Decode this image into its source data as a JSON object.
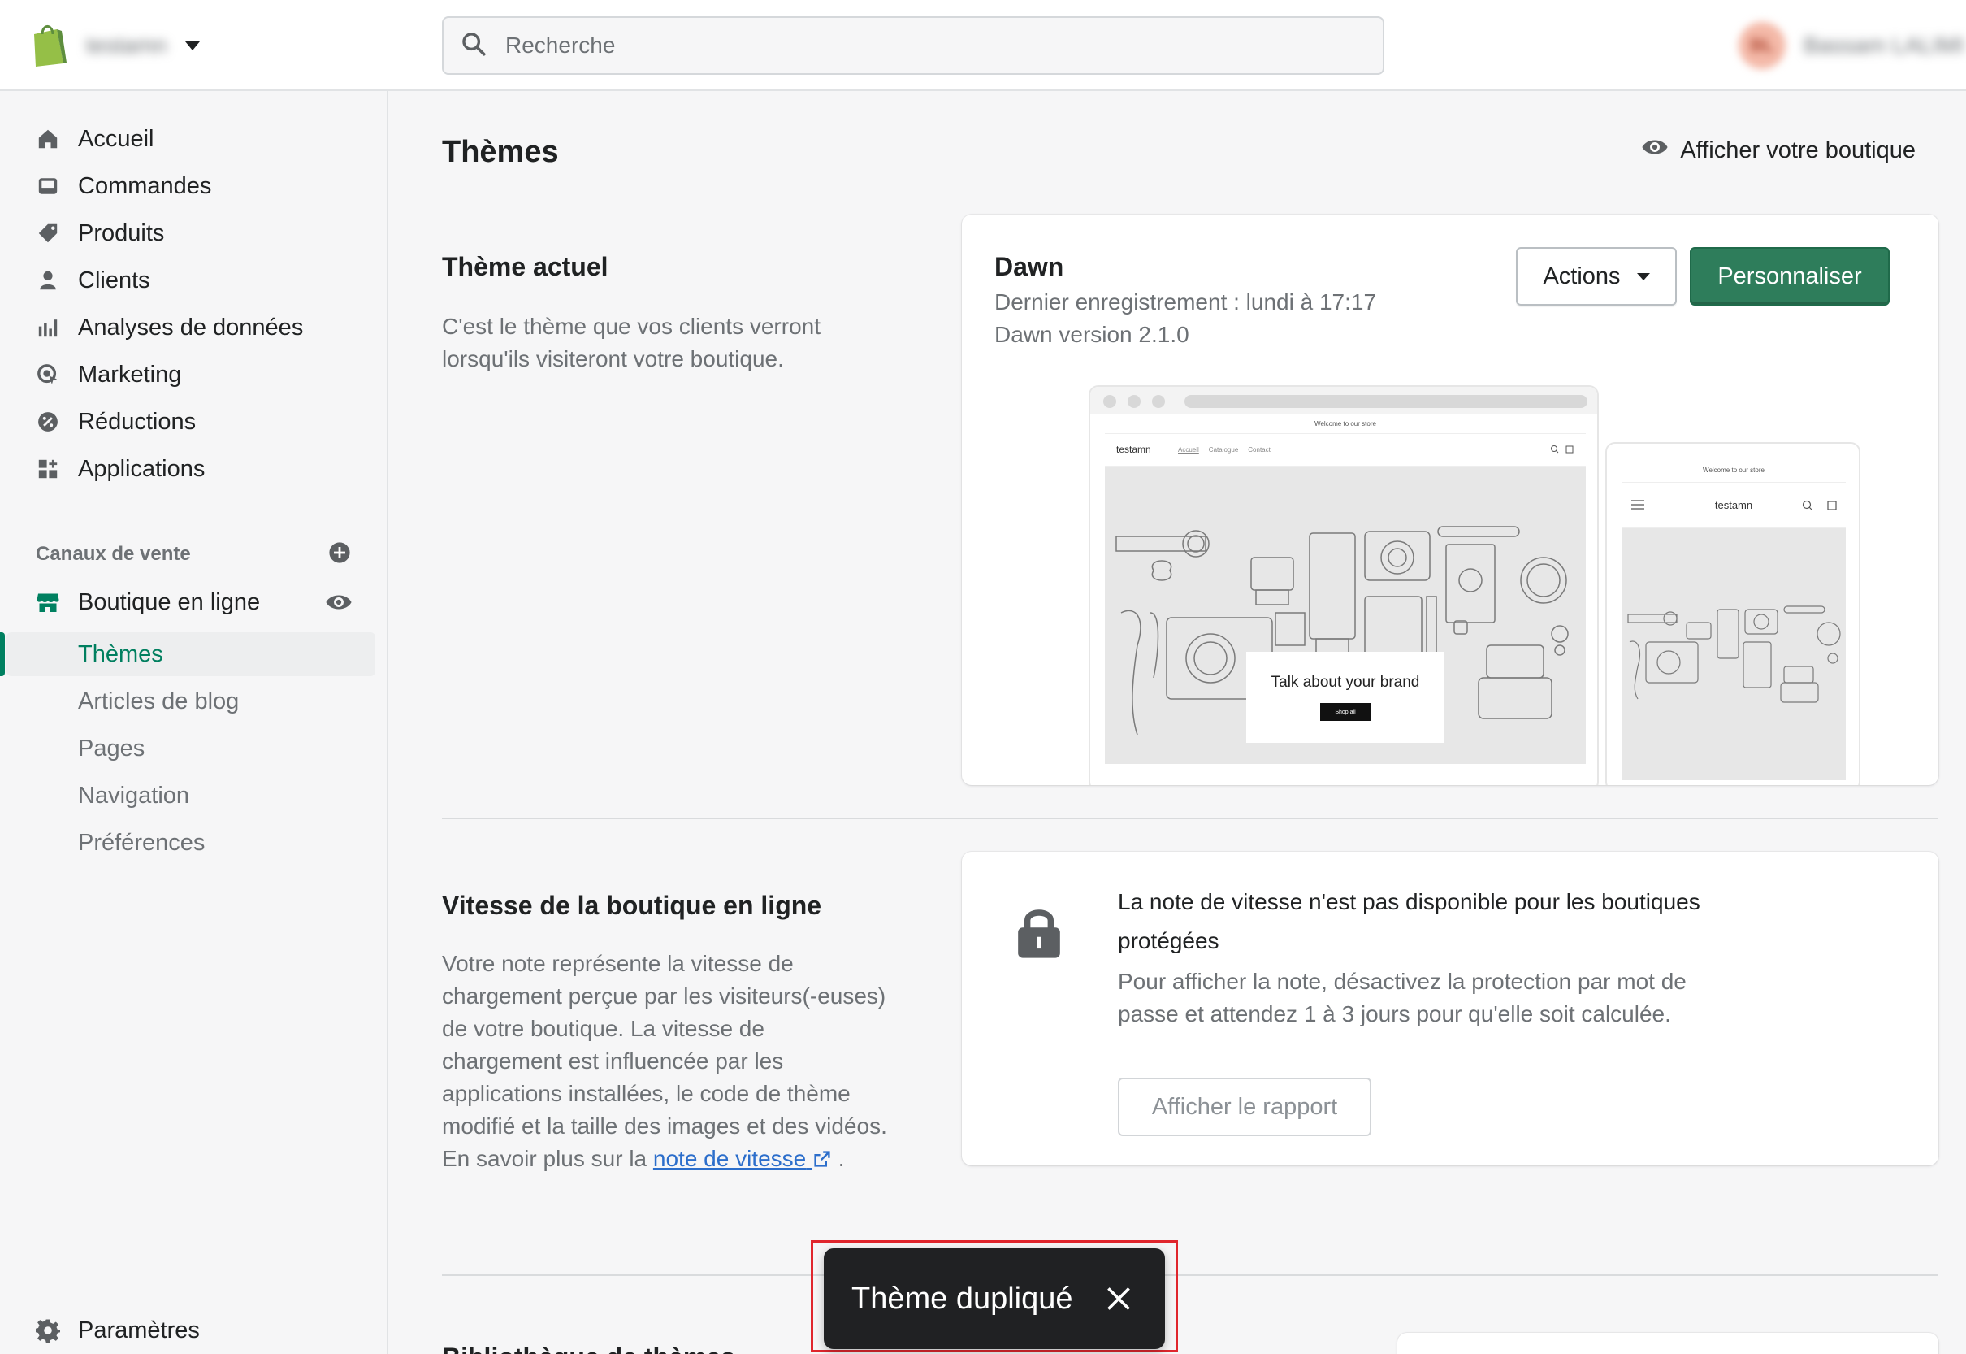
{
  "topbar": {
    "store_name": "testamn",
    "search_placeholder": "Recherche",
    "user_initials": "BL",
    "user_name": "Bassam LALIMI"
  },
  "sidebar": {
    "items": [
      {
        "label": "Accueil",
        "icon": "home-icon"
      },
      {
        "label": "Commandes",
        "icon": "orders-icon"
      },
      {
        "label": "Produits",
        "icon": "tag-icon"
      },
      {
        "label": "Clients",
        "icon": "person-icon"
      },
      {
        "label": "Analyses de données",
        "icon": "bar-chart-icon"
      },
      {
        "label": "Marketing",
        "icon": "target-icon"
      },
      {
        "label": "Réductions",
        "icon": "discount-icon"
      },
      {
        "label": "Applications",
        "icon": "apps-icon"
      }
    ],
    "sales_channels_label": "Canaux de vente",
    "online_store": {
      "label": "Boutique en ligne",
      "subitems": [
        "Thèmes",
        "Articles de blog",
        "Pages",
        "Navigation",
        "Préférences"
      ],
      "active_subitem": "Thèmes"
    },
    "settings_label": "Paramètres"
  },
  "main": {
    "title": "Thèmes",
    "view_store_label": "Afficher votre boutique",
    "current_theme": {
      "section_title": "Thème actuel",
      "section_desc": "C'est le thème que vos clients verront lorsqu'ils visiteront votre boutique.",
      "name": "Dawn",
      "last_saved": "Dernier enregistrement : lundi à 17:17",
      "version": "Dawn version 2.1.0",
      "actions_label": "Actions",
      "customize_label": "Personnaliser",
      "preview": {
        "announcement": "Welcome to our store",
        "store_name": "testamn",
        "nav_links": [
          "Accueil",
          "Catalogue",
          "Contact"
        ],
        "hero_text": "Talk about your brand",
        "hero_button": "Shop all"
      }
    },
    "speed": {
      "section_title": "Vitesse de la boutique en ligne",
      "section_desc": "Votre note représente la vitesse de chargement perçue par les visiteurs(-euses) de votre boutique. La vitesse de chargement est influencée par les applications installées, le code de thème modifié et la taille des images et des vidéos. En savoir plus sur la",
      "link_text": "note de vitesse",
      "desc_end": ".",
      "card_title": "La note de vitesse n'est pas disponible pour les boutiques protégées",
      "card_desc": "Pour afficher la note, désactivez la protection par mot de passe et attendez 1 à 3 jours pour qu'elle soit calculée.",
      "report_button": "Afficher le rapport"
    },
    "third_section_title": "Bibliothèque de thèmes"
  },
  "toast": {
    "message": "Thème dupliqué"
  },
  "colors": {
    "primary": "#2e7d5b",
    "active_green": "#008060",
    "toast_bg": "#202123",
    "highlight_red": "#e0262d"
  }
}
